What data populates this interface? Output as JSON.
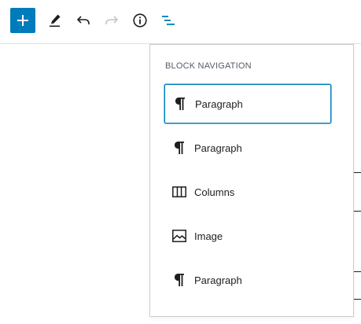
{
  "toolbar": {
    "add_icon": "plus-icon",
    "tools_icon": "pencil-icon",
    "undo_icon": "undo-icon",
    "redo_icon": "redo-icon",
    "info_icon": "info-icon",
    "nav_icon": "list-view-icon",
    "accent_color": "#007cba"
  },
  "block_navigation": {
    "title": "Block Navigation",
    "items": [
      {
        "label": "Paragraph",
        "icon": "paragraph-icon",
        "selected": true
      },
      {
        "label": "Paragraph",
        "icon": "paragraph-icon",
        "selected": false
      },
      {
        "label": "Columns",
        "icon": "columns-icon",
        "selected": false
      },
      {
        "label": "Image",
        "icon": "image-icon",
        "selected": false
      },
      {
        "label": "Paragraph",
        "icon": "paragraph-icon",
        "selected": false
      }
    ]
  }
}
